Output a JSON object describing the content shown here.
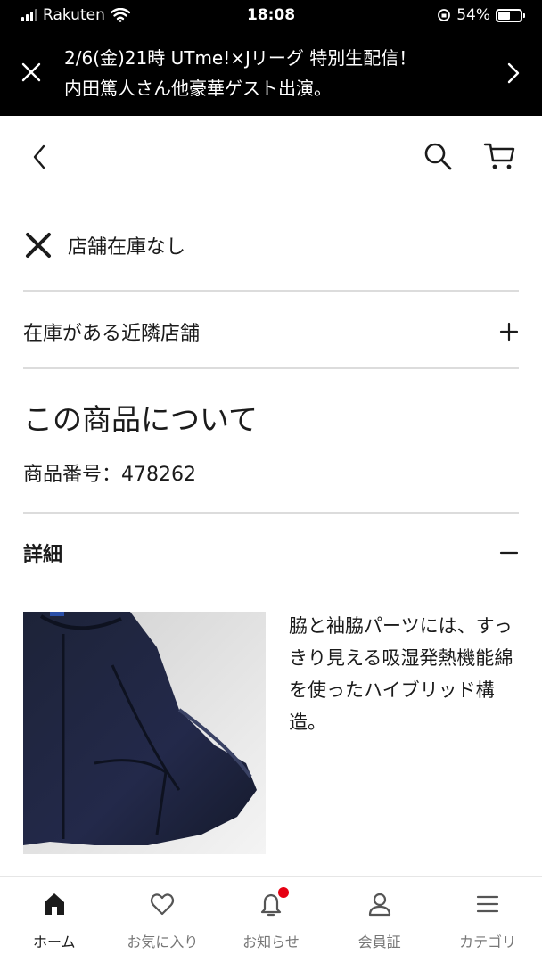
{
  "status_bar": {
    "carrier": "Rakuten",
    "time": "18:08",
    "battery": "54%",
    "battery_level": 0.54
  },
  "banner": {
    "line1": "2/6(金)21時 UTme!×Jリーグ 特別生配信！",
    "line2": "内田篤人さん他豪華ゲスト出演。"
  },
  "store": {
    "stock_status": "店舗在庫なし"
  },
  "nearby": {
    "label": "在庫がある近隣店舗"
  },
  "about": {
    "title": "この商品について",
    "product_number": "商品番号：478262"
  },
  "details": {
    "title": "詳細",
    "description": "脇と袖脇パーツには、すっきり見える吸湿発熱機能綿を使ったハイブリッド構造。"
  },
  "tabbar": {
    "items": [
      {
        "label": "ホーム",
        "icon": "home-icon"
      },
      {
        "label": "お気に入り",
        "icon": "heart-icon"
      },
      {
        "label": "お知らせ",
        "icon": "bell-icon"
      },
      {
        "label": "会員証",
        "icon": "person-icon"
      },
      {
        "label": "カテゴリ",
        "icon": "menu-icon"
      }
    ]
  },
  "colors": {
    "accent_red": "#e60012",
    "link_blue": "#2a69c4",
    "banner_bg": "#000000"
  }
}
